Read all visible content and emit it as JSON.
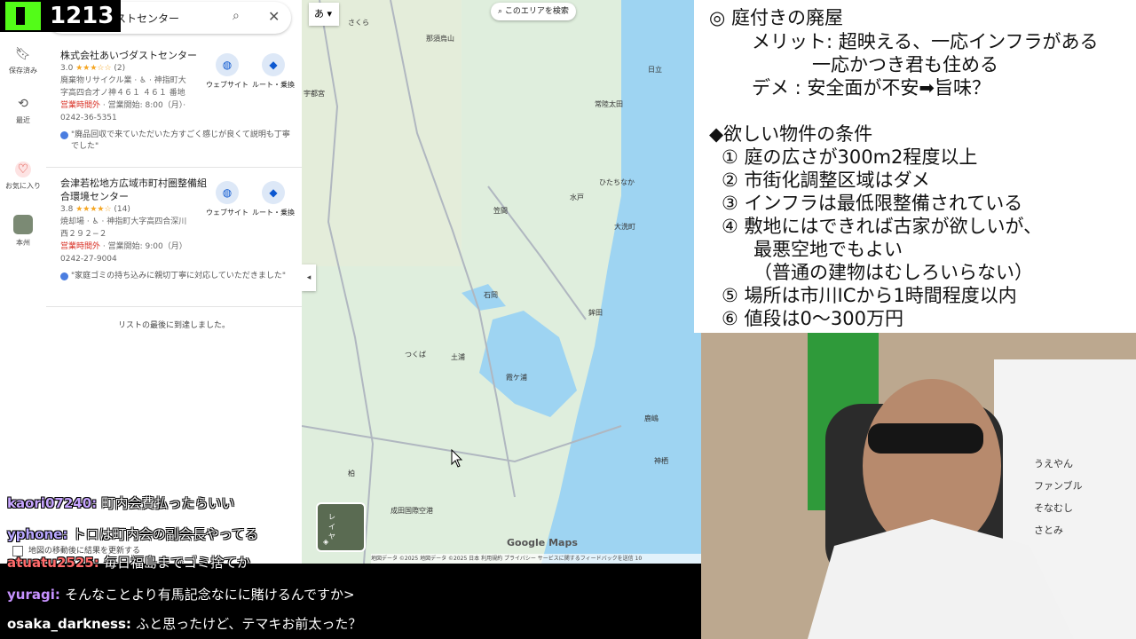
{
  "stream": {
    "viewer_count": "1213"
  },
  "rail": {
    "items": [
      {
        "label": "保存済み",
        "icon": "bookmark-icon"
      },
      {
        "label": "最近",
        "icon": "history-icon"
      },
      {
        "label": "お気に入り",
        "icon": "heart-icon"
      },
      {
        "label": "本州",
        "icon": "map-thumbnail-icon"
      }
    ]
  },
  "search": {
    "query": "ストセンター"
  },
  "results": [
    {
      "name": "株式会社あいづダストセンター",
      "rating": "3.0",
      "stars": "★★★☆☆",
      "count": "(2)",
      "category_address": "廃棄物リサイクル業 · ♿ · 神指町大",
      "address2": "字高四合才ノ神４６１ ４６１ 番地",
      "status": "営業時間外",
      "open_text": " · 営業開始: 8:00（月）·",
      "phone": "0242-36-5351",
      "review": "\"廃品回収で来ていただいた方すごく感じが良くて説明も丁寧でした\"",
      "website_label": "ウェブサイト",
      "route_label": "ルート・乗換"
    },
    {
      "name": "会津若松地方広域市町村圏整備組合環境センター",
      "rating": "3.8",
      "stars": "★★★★☆",
      "count": "(14)",
      "category_address": "焼却場 · ♿ · 神指町大字高四合深川",
      "address2": "西２９２−２",
      "status": "営業時間外",
      "open_text": " · 営業開始: 9:00（月）",
      "phone": "0242-27-9004",
      "review": "\"家庭ゴミの持ち込みに親切丁寧に対応していただきました\"",
      "website_label": "ウェブサイト",
      "route_label": "ルート・乗換"
    }
  ],
  "end_of_list": "リストの最後に到達しました。",
  "update_checkbox": "地図の移動後に結果を更新する",
  "map": {
    "search_area_button": "このエリアを検索",
    "lang_button": "あ",
    "layer_button": "レイヤ",
    "logo": "Google Maps",
    "attribution": "地図データ ©2025  地図データ ©2025  日本  利用規約  プライバシー  サービスに関するフィードバックを送信  10",
    "labels": [
      "さくら",
      "那須烏山",
      "宇都宮",
      "日立",
      "常陸太田",
      "ひたちなか",
      "水戸",
      "大洗町",
      "笠間",
      "石岡",
      "鉾田",
      "つくば",
      "土浦",
      "霞ケ浦",
      "鹿嶋",
      "神栖",
      "柏",
      "成田国際空港"
    ]
  },
  "chat": [
    {
      "user": "kaori07240",
      "user_color": "#c7a6ff",
      "text": "町内会費払ったらいい"
    },
    {
      "user": "yphone",
      "user_color": "#b8a7ff",
      "text": "トロは町内会の副会長やってる"
    },
    {
      "user": "atuatu2525",
      "user_color": "#ff6b6b",
      "text": "毎日福島までゴミ捨てか"
    },
    {
      "user": "yuragi",
      "user_color": "#c792ff",
      "text": "そんなことより有馬記念なにに賭けるんですか>"
    },
    {
      "user": "osaka_darkness",
      "user_color": "#ffffff",
      "text": "ふと思ったけど、テマキお前太った？"
    }
  ],
  "notes": {
    "lines": [
      "◎ 庭付きの廃屋",
      "メリット: 超映える、一応インフラがある",
      "一応かつき君も住める",
      "デメ : 安全面が不安➡旨味？",
      "◆欲しい物件の条件",
      "① 庭の広さが300m2程度以上",
      "② 市街化調整区域はダメ",
      "③ インフラは最低限整備されている",
      "④ 敷地にはできれば古家が欲しいが、",
      "最悪空地でもよい",
      "（普通の建物はむしろいらない）",
      "⑤ 場所は市川ICから1時間程度以内",
      "⑥ 値段は0～300万円"
    ]
  },
  "cam": {
    "board_names": [
      "うえやん",
      "ファンブル",
      "そなむし",
      "さとみ"
    ]
  },
  "colors": {
    "accent_green": "#53fc18",
    "google_blue": "#0b57d0",
    "closed_red": "#d93025"
  }
}
